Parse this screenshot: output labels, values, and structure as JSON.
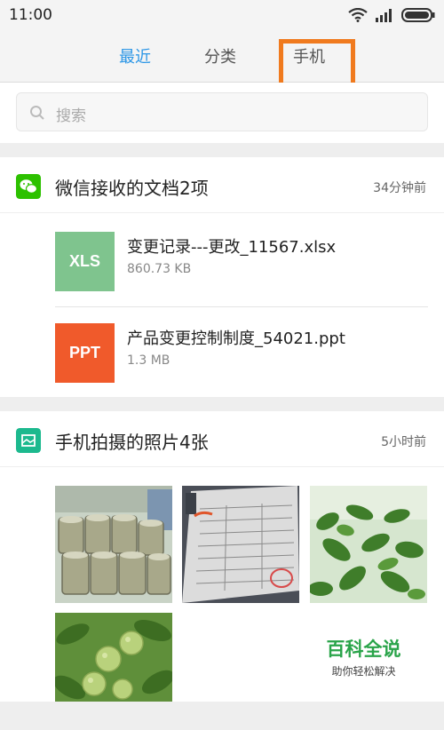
{
  "status_bar": {
    "time": "11:00"
  },
  "tabs": [
    {
      "label": "最近",
      "active": true
    },
    {
      "label": "分类",
      "active": false
    },
    {
      "label": "手机",
      "active": false
    }
  ],
  "search": {
    "placeholder": "搜索"
  },
  "groups": [
    {
      "title": "微信接收的文档2项",
      "time": "34分钟前",
      "icon": "wechat-icon",
      "files": [
        {
          "badge": "XLS",
          "name": "变更记录---更改_11567.xlsx",
          "size": "860.73 KB",
          "color": "#7fc48e"
        },
        {
          "badge": "PPT",
          "name": "产品变更控制制度_54021.ppt",
          "size": "1.3 MB",
          "color": "#f05a2b"
        }
      ]
    },
    {
      "title": "手机拍摄的照片4张",
      "time": "5小时前",
      "icon": "gallery-icon",
      "photos": [
        "cans-photo",
        "document-photo",
        "leaves-photo",
        "walnut-photo"
      ]
    }
  ],
  "watermark": {
    "title": "百科全说",
    "subtitle": "助你轻松解决"
  },
  "colors": {
    "accent": "#2b96e6",
    "highlight": "#f07a1e",
    "wechat": "#2dc100",
    "gallery": "#1cb98e"
  }
}
